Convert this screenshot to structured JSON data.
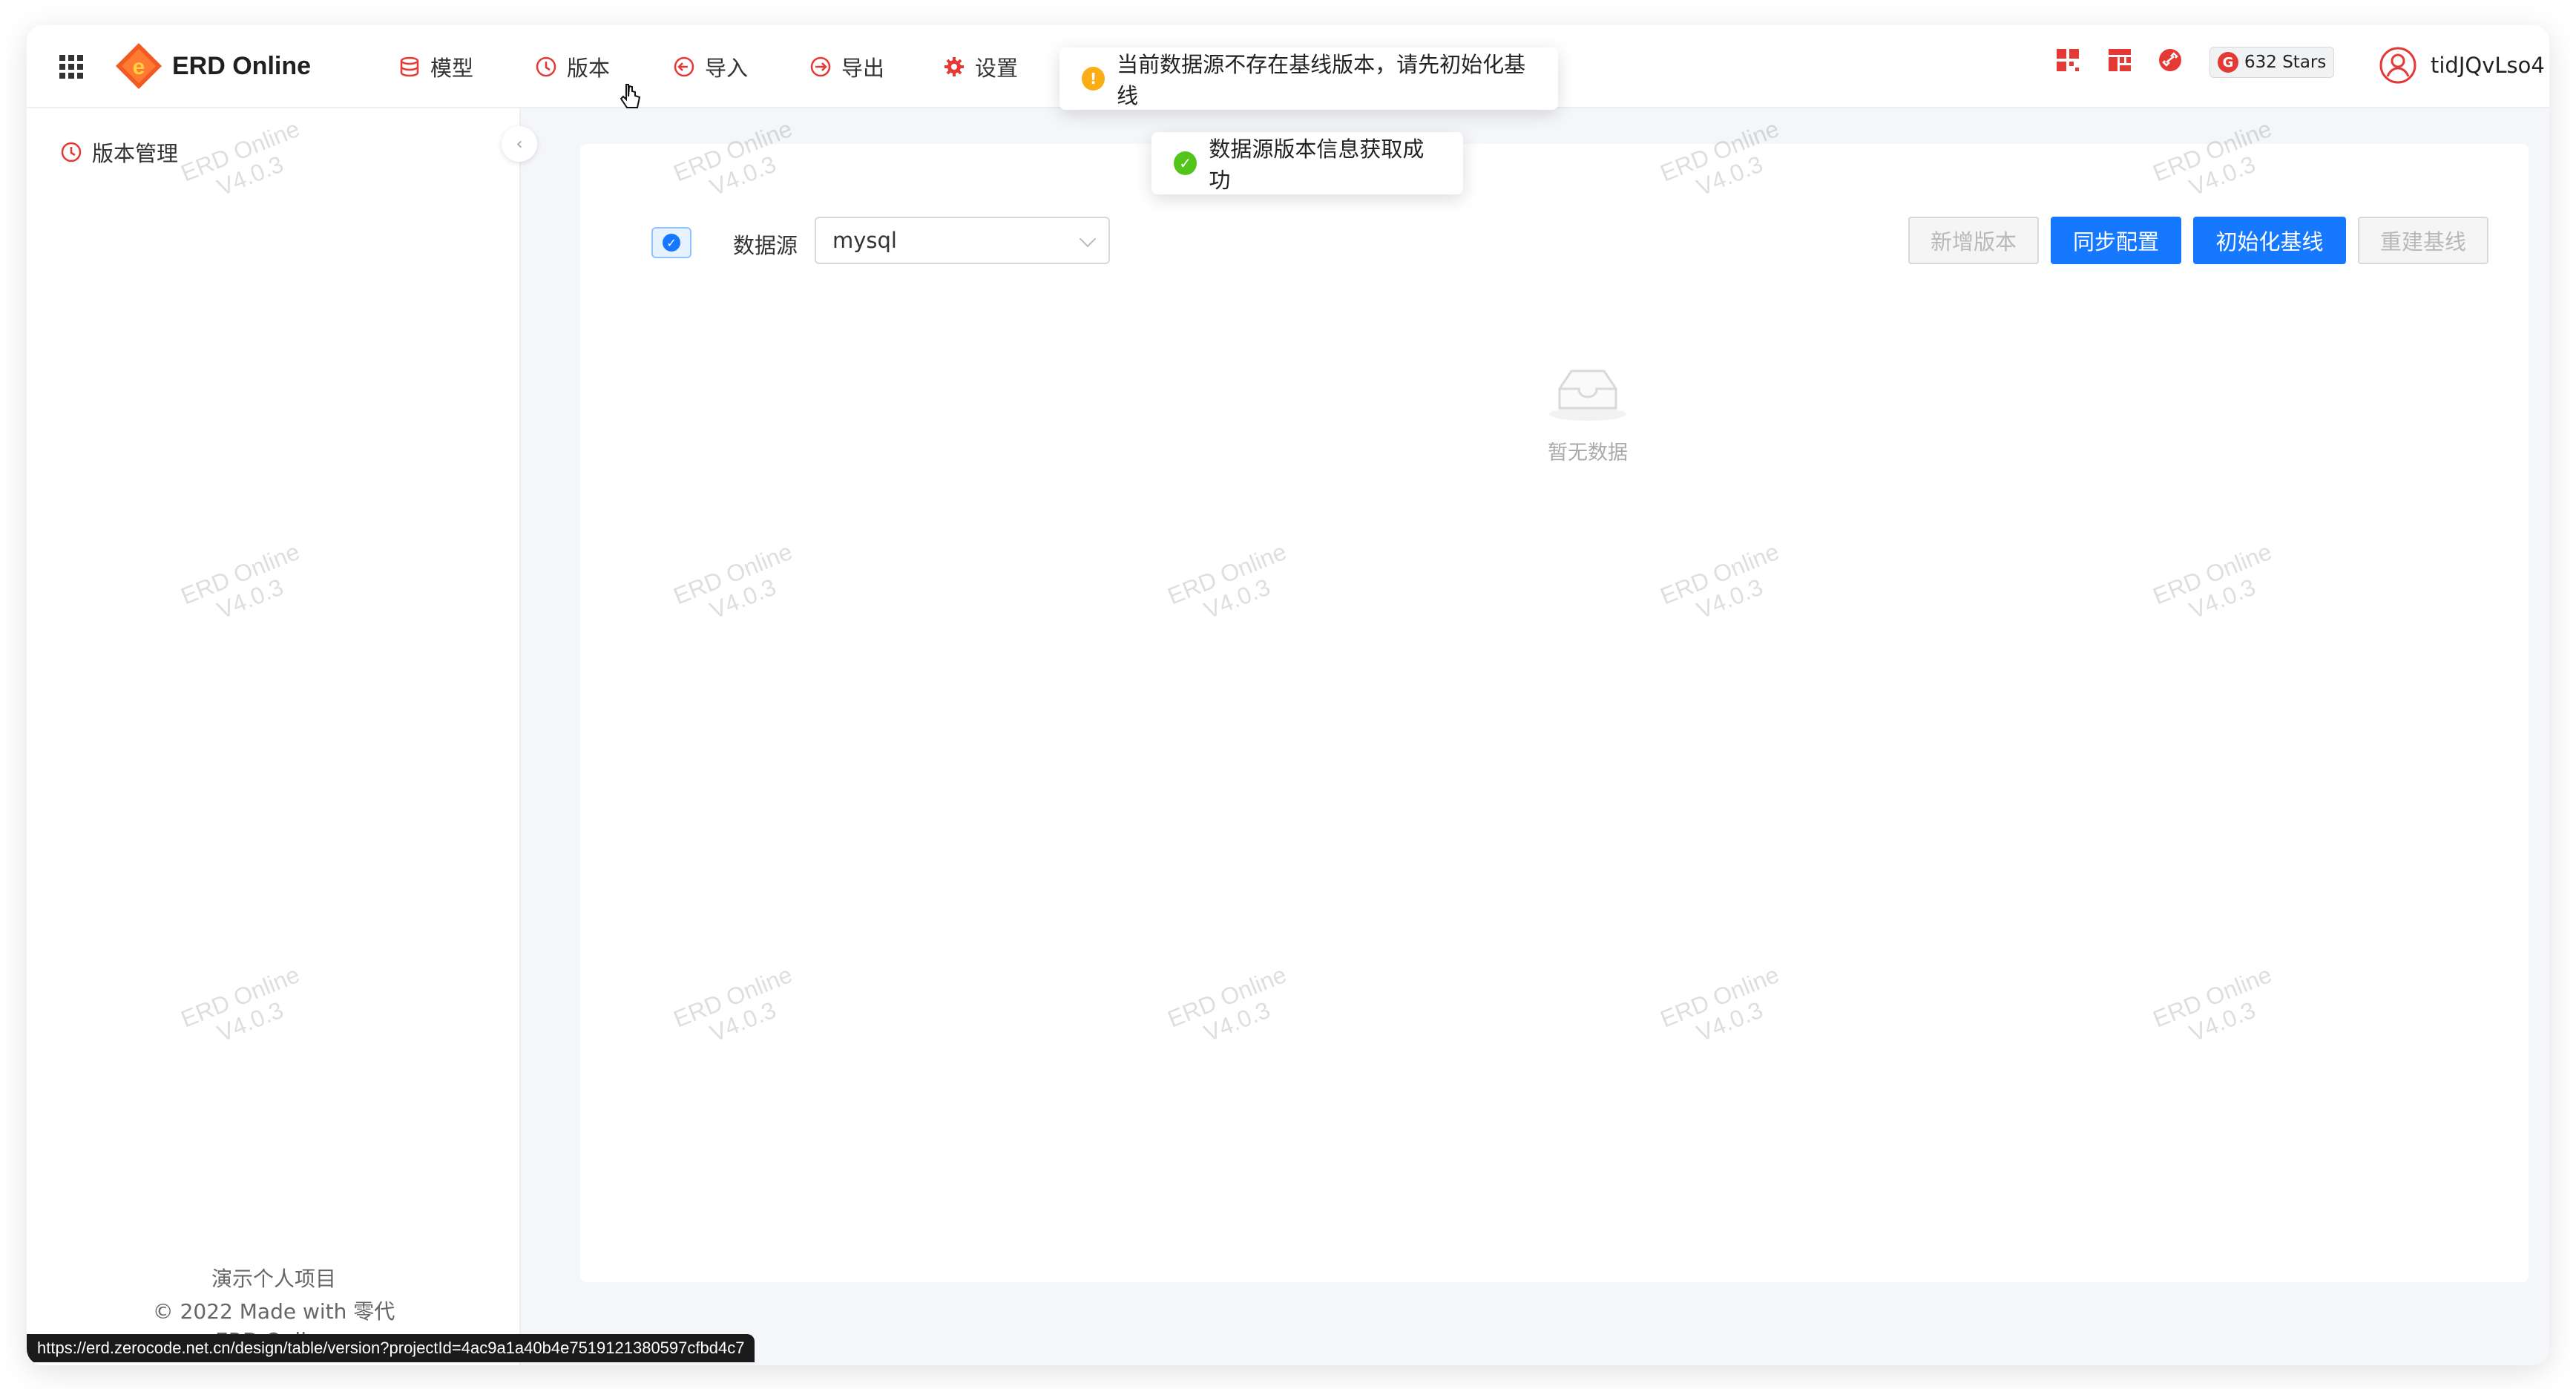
{
  "header": {
    "brand": "ERD Online",
    "nav": [
      {
        "label": "模型",
        "icon": "database-icon"
      },
      {
        "label": "版本",
        "icon": "history-icon"
      },
      {
        "label": "导入",
        "icon": "import-icon"
      },
      {
        "label": "导出",
        "icon": "export-icon"
      },
      {
        "label": "设置",
        "icon": "gear-icon"
      }
    ],
    "stars_label": "632 Stars",
    "username": "tidJQvLso4"
  },
  "sidebar": {
    "item_label": "版本管理",
    "footer_project": "演示个人项目",
    "footer_copyright": "© 2022 Made with 零代",
    "footer_brand": "ERD Online"
  },
  "toolbar": {
    "datasource_label": "数据源",
    "datasource_value": "mysql",
    "buttons": {
      "add_version": "新增版本",
      "sync_config": "同步配置",
      "init_baseline": "初始化基线",
      "rebuild_baseline": "重建基线"
    }
  },
  "empty": {
    "text": "暂无数据"
  },
  "toasts": {
    "warning": "当前数据源不存在基线版本，请先初始化基线",
    "success": "数据源版本信息获取成功"
  },
  "watermark": {
    "line1": "ERD Online",
    "line2": "V4.0.3"
  },
  "status_bar": {
    "url": "https://erd.zerocode.net.cn/design/table/version?projectId=4ac9a1a40b4e7519121380597cfbd4c7"
  },
  "colors": {
    "primary": "#1677ff",
    "warning": "#faad14",
    "success": "#52c41a",
    "icon_red": "#e53935"
  }
}
